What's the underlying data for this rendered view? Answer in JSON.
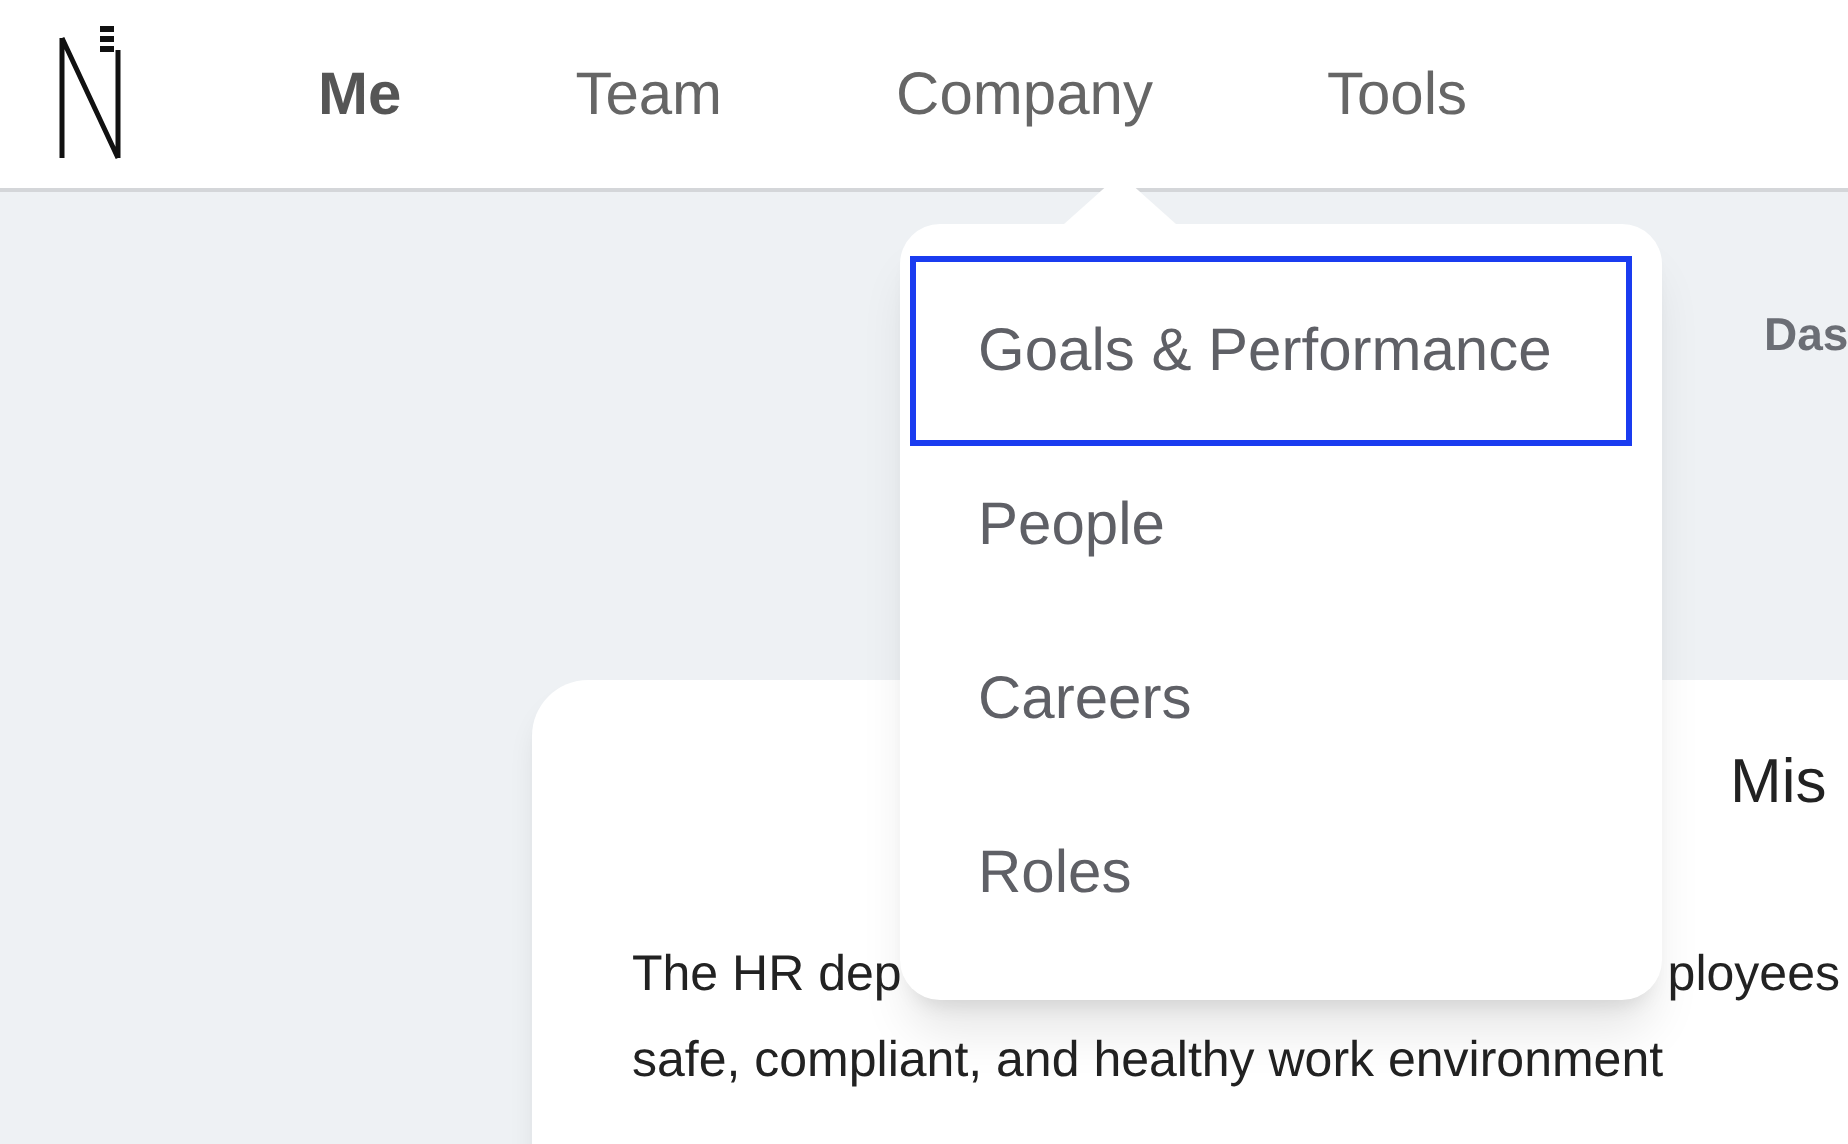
{
  "nav": [
    {
      "label": "Me",
      "selected": true
    },
    {
      "label": "Team",
      "selected": false
    },
    {
      "label": "Company",
      "selected": false,
      "expanded": true
    },
    {
      "label": "Tools",
      "selected": false
    }
  ],
  "dropdown": [
    {
      "label": "Goals & Performance",
      "selected": true
    },
    {
      "label": "People",
      "selected": false
    },
    {
      "label": "Careers",
      "selected": false
    },
    {
      "label": "Roles",
      "selected": false
    }
  ],
  "side_heading": "Das",
  "card": {
    "title": "Mis",
    "line_1_start": "The HR dep",
    "line_1_end": "ployees",
    "line_2": "safe, compliant, and healthy work environment"
  }
}
